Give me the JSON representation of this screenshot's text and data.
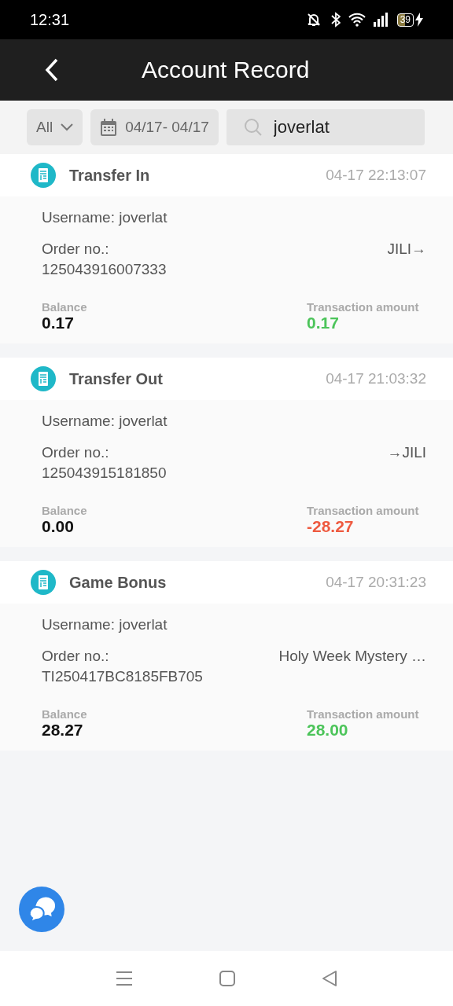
{
  "status_bar": {
    "time": "12:31",
    "battery": "39"
  },
  "header": {
    "title": "Account Record"
  },
  "filters": {
    "type": "All",
    "date_range": "04/17- 04/17",
    "search_value": "joverlat"
  },
  "records": [
    {
      "title": "Transfer In",
      "time": "04-17 22:13:07",
      "username": "Username: joverlat",
      "order_label": "Order no.:",
      "order_no": "125043916007333",
      "target": "JILI→",
      "balance_label": "Balance",
      "balance": "0.17",
      "amount_label": "Transaction amount",
      "amount": "0.17",
      "color": "#4cc45a"
    },
    {
      "title": "Transfer Out",
      "time": "04-17 21:03:32",
      "username": "Username: joverlat",
      "order_label": "Order no.:",
      "order_no": "125043915181850",
      "target": "→JILI",
      "balance_label": "Balance",
      "balance": "0.00",
      "amount_label": "Transaction amount",
      "amount": "-28.27",
      "color": "#ee5a40"
    },
    {
      "title": "Game Bonus",
      "time": "04-17 20:31:23",
      "username": "Username: joverlat",
      "order_label": "Order no.:",
      "order_no": "TI250417BC8185FB705",
      "target": "Holy Week Mystery …",
      "balance_label": "Balance",
      "balance": "28.27",
      "amount_label": "Transaction amount",
      "amount": "28.00",
      "color": "#4cc45a"
    }
  ]
}
